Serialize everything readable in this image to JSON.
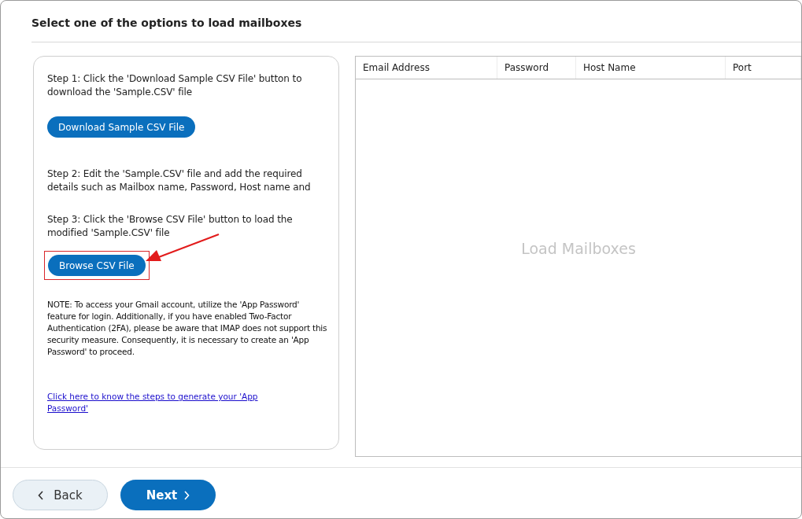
{
  "heading": "Select one of the options to load mailboxes",
  "steps": [
    {
      "text": "Step 1: Click the 'Download Sample CSV File' button to download the 'Sample.CSV' file",
      "button": "Download Sample CSV File",
      "highlighted": false
    },
    {
      "text": "Step 2: Edit the 'Sample.CSV' file and add the required details such as Mailbox name, Password, Host name and"
    },
    {
      "text": "Step 3: Click the 'Browse CSV File' button to load the modified 'Sample.CSV' file",
      "button": "Browse CSV File",
      "highlighted": true
    }
  ],
  "note": "NOTE: To access your Gmail account, utilize the 'App Password' feature for login. Additionally, if you have enabled Two-Factor Authentication (2FA), please be aware that IMAP does not support this security measure. Consequently, it is necessary to create an 'App Password' to proceed.",
  "help_link": "Click here to know the steps to generate your 'App Password'",
  "table": {
    "columns": [
      "Email Address",
      "Password",
      "Host Name",
      "Port"
    ],
    "empty_text": "Load Mailboxes"
  },
  "footer": {
    "back": "Back",
    "next": "Next"
  }
}
